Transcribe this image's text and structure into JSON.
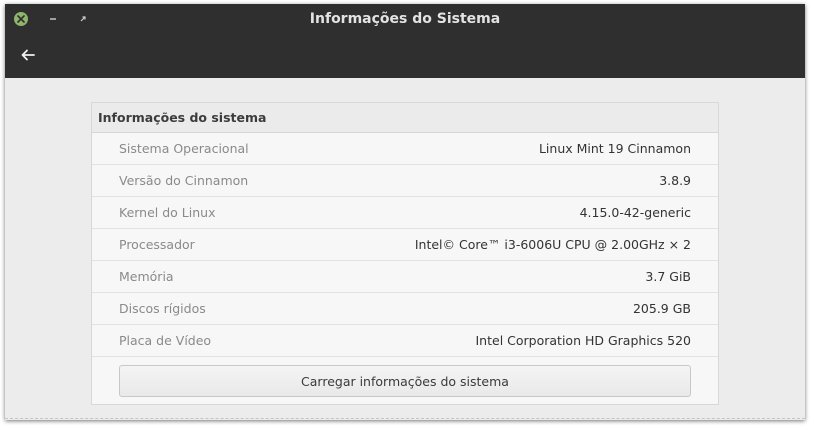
{
  "window": {
    "title": "Informações do Sistema",
    "controls": {
      "close_icon": "close-icon",
      "minimize_icon": "minimize-icon",
      "maximize_icon": "maximize-icon"
    },
    "back_icon": "back-arrow-icon"
  },
  "panel": {
    "header": "Informações do sistema",
    "rows": [
      {
        "label": "Sistema Operacional",
        "value": "Linux Mint 19 Cinnamon"
      },
      {
        "label": "Versão do Cinnamon",
        "value": "3.8.9"
      },
      {
        "label": "Kernel do Linux",
        "value": "4.15.0-42-generic"
      },
      {
        "label": "Processador",
        "value": "Intel© Core™ i3-6006U CPU @ 2.00GHz × 2"
      },
      {
        "label": "Memória",
        "value": "3.7 GiB"
      },
      {
        "label": "Discos rígidos",
        "value": "205.9 GB"
      },
      {
        "label": "Placa de Vídeo",
        "value": "Intel Corporation HD Graphics 520"
      }
    ],
    "button_label": "Carregar informações do sistema"
  },
  "colors": {
    "titlebar": "#2f2f2f",
    "window_bg": "#ececec",
    "close_button": "#8fb56b"
  }
}
